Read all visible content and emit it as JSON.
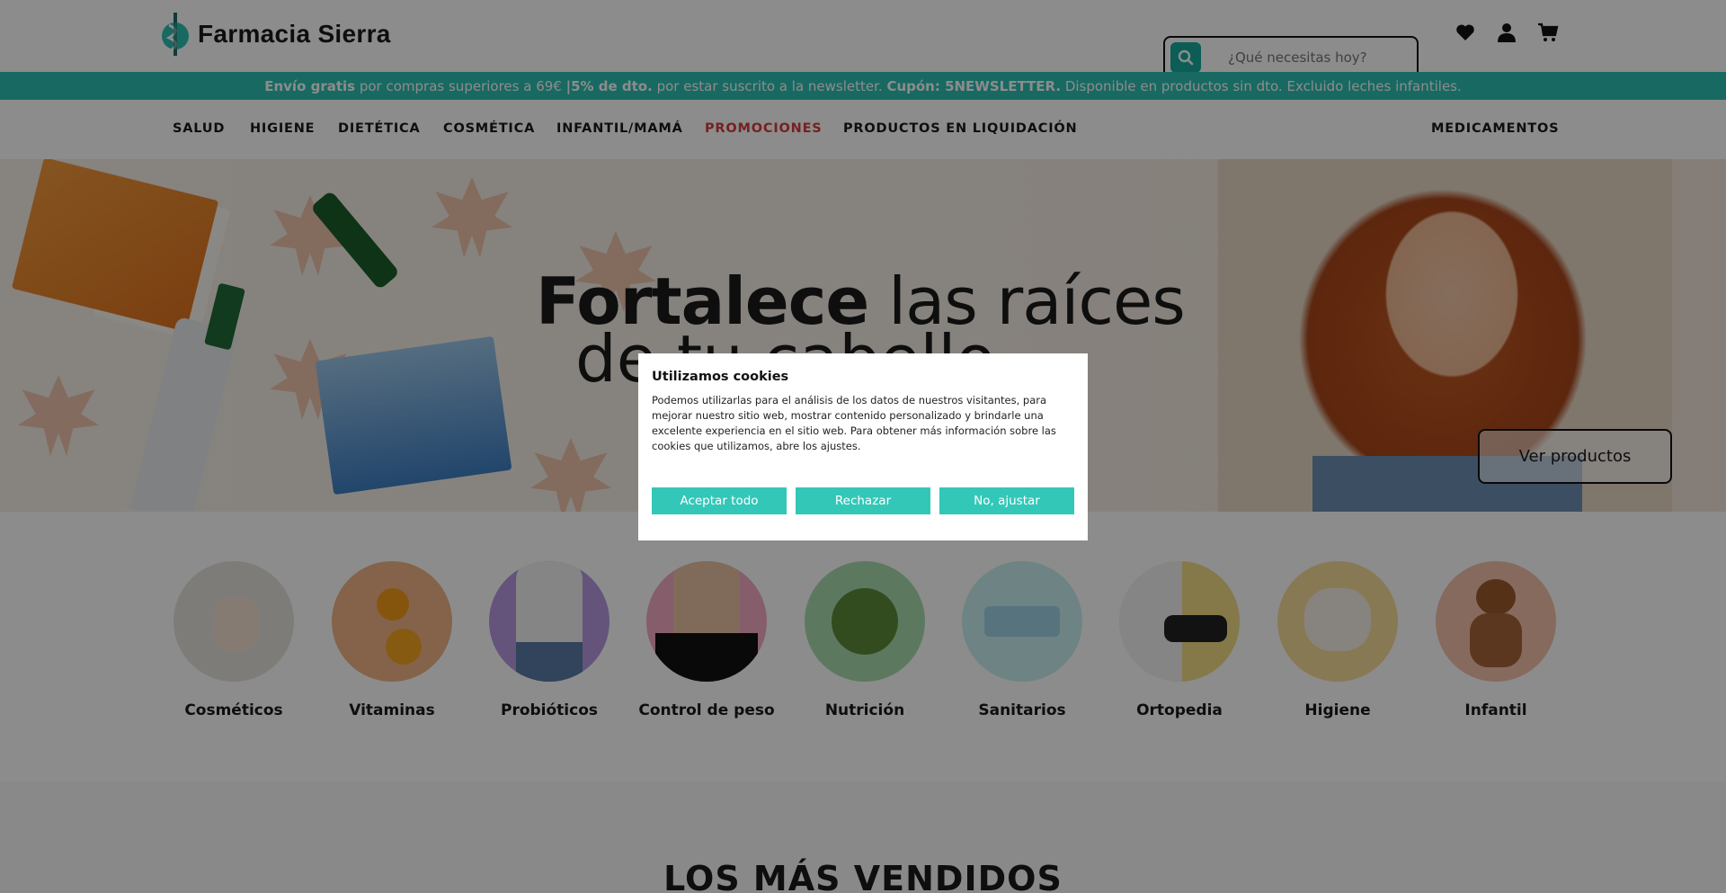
{
  "brand": {
    "name": "Farmacia Sierra",
    "accent": "#2dbfb2",
    "promo_red": "#d83b3b"
  },
  "search": {
    "placeholder": "¿Qué necesitas hoy?"
  },
  "header_icons": [
    "heart-icon",
    "user-icon",
    "cart-icon"
  ],
  "promo_bar": {
    "part1_bold": "Envío gratis",
    "part1": " por compras superiores a 69€ ",
    "sep": " | ",
    "part2_bold": " 5% de dto.",
    "part2": " por estar suscrito a la newsletter. ",
    "part3_bold": "Cupón: 5NEWSLETTER.",
    "part3": " Disponible en productos sin dto. Excluido leches infantiles."
  },
  "nav": {
    "items": [
      "SALUD",
      "HIGIENE",
      "DIETÉTICA",
      "COSMÉTICA",
      "INFANTIL/MAMÁ",
      "PROMOCIONES",
      "PRODUCTOS EN LIQUIDACIÓN"
    ],
    "right": "MEDICAMENTOS"
  },
  "hero": {
    "title_bold": "Fortalece",
    "title_rest": " las raíces",
    "title_line2": "de tu cabello",
    "cta": "Ver productos"
  },
  "categories": [
    {
      "label": "Cosméticos",
      "color": "#e6e2da"
    },
    {
      "label": "Vitaminas",
      "color": "#f0b487"
    },
    {
      "label": "Probióticos",
      "color": "#b79ae0"
    },
    {
      "label": "Control de peso",
      "color": "#f3a9c4"
    },
    {
      "label": "Nutrición",
      "color": "#a8dcae"
    },
    {
      "label": "Sanitarios",
      "color": "#c6eef0"
    },
    {
      "label": "Ortopedia",
      "color": "#f2da86"
    },
    {
      "label": "Higiene",
      "color": "#f7dc9c"
    },
    {
      "label": "Infantil",
      "color": "#f4c1a9"
    }
  ],
  "section": {
    "title": "LOS MÁS VENDIDOS"
  },
  "cookie": {
    "title": "Utilizamos cookies",
    "text": "Podemos utilizarlas para el análisis de los datos de nuestros visitantes, para mejorar nuestro sitio web, mostrar contenido personalizado y brindarle una excelente experiencia en el sitio web. Para obtener más información sobre las cookies que utilizamos, abre los ajustes.",
    "accept": "Aceptar todo",
    "reject": "Rechazar",
    "adjust": "No, ajustar"
  }
}
